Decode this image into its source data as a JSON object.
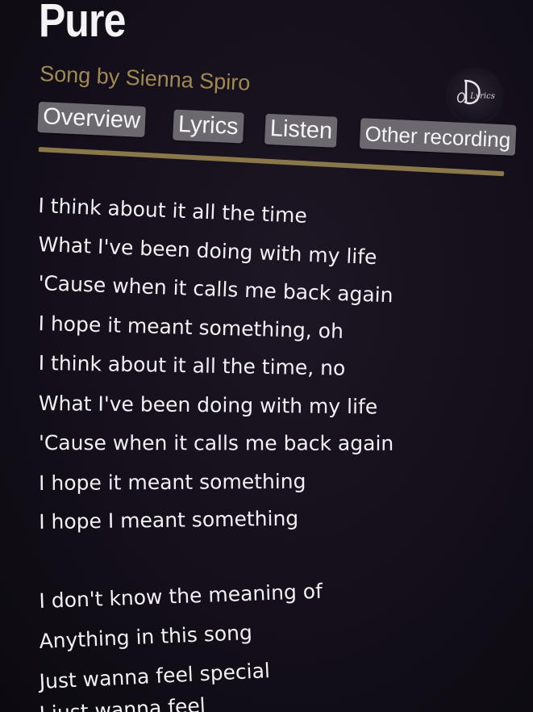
{
  "song": {
    "title": "Pure",
    "subtitle": "Song by Sienna Spiro"
  },
  "logo": {
    "icon": "lyrics-logo-icon",
    "text": "Lyrics"
  },
  "tabs": [
    {
      "label": "Overview"
    },
    {
      "label": "Lyrics"
    },
    {
      "label": "Listen"
    },
    {
      "label": "Other recording"
    }
  ],
  "colors": {
    "background": "#140f1a",
    "subtitle": "#a08a52",
    "divider": "#8a774a",
    "tab_bg": "#6b6870",
    "text": "#f2f0f4"
  },
  "lyrics": [
    "I think about it all the time",
    "What I've been doing with my life",
    "'Cause when it calls me back again",
    "I hope it meant something, oh",
    "I think about it all the time, no",
    "What I've been doing with my life",
    "'Cause when it calls me back again",
    "I hope it meant something",
    "I hope I meant something",
    "I don't know the meaning of",
    "Anything in this song",
    "Just wanna feel special",
    "I just wanna feel"
  ]
}
